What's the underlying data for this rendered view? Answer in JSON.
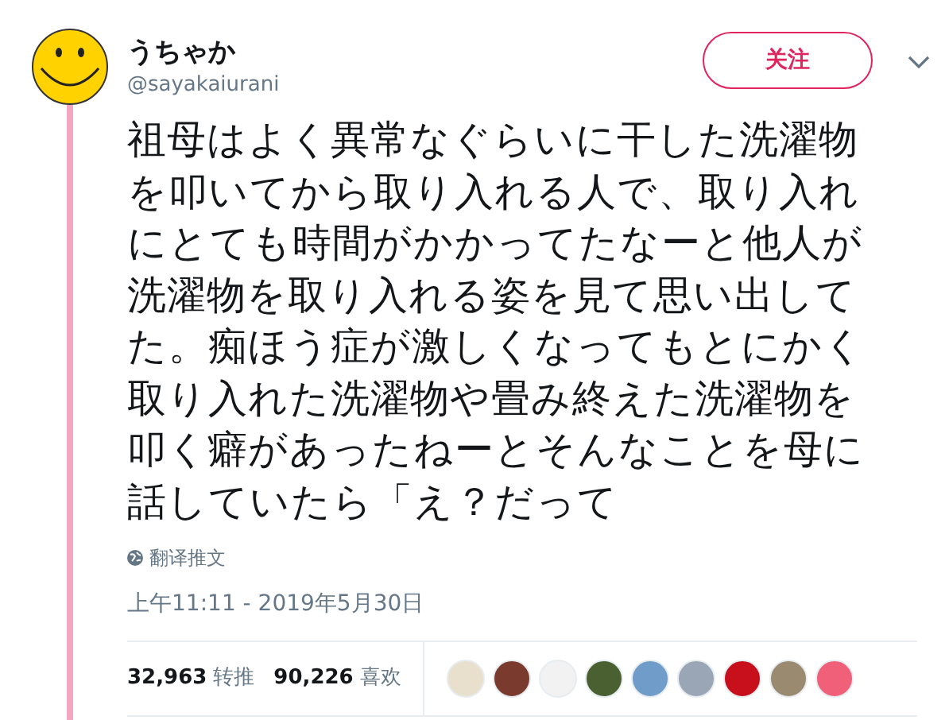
{
  "author": {
    "name": "うちゃか",
    "handle": "@sayakaiurani"
  },
  "follow_button": "关注",
  "tweet_text": "祖母はよく異常なぐらいに干した洗濯物を叩いてから取り入れる人で、取り入れにとても時間がかかってたなーと他人が洗濯物を取り入れる姿を見て思い出してた。痴ほう症が激しくなってもとにかく取り入れた洗濯物や畳み終えた洗濯物を叩く癖があったねーとそんなことを母に話していたら「え？だって",
  "translate_link": "翻译推文",
  "timestamp": "上午11:11 - 2019年5月30日",
  "stats": [
    {
      "count": "32,963",
      "label": "转推"
    },
    {
      "count": "90,226",
      "label": "喜欢"
    }
  ]
}
